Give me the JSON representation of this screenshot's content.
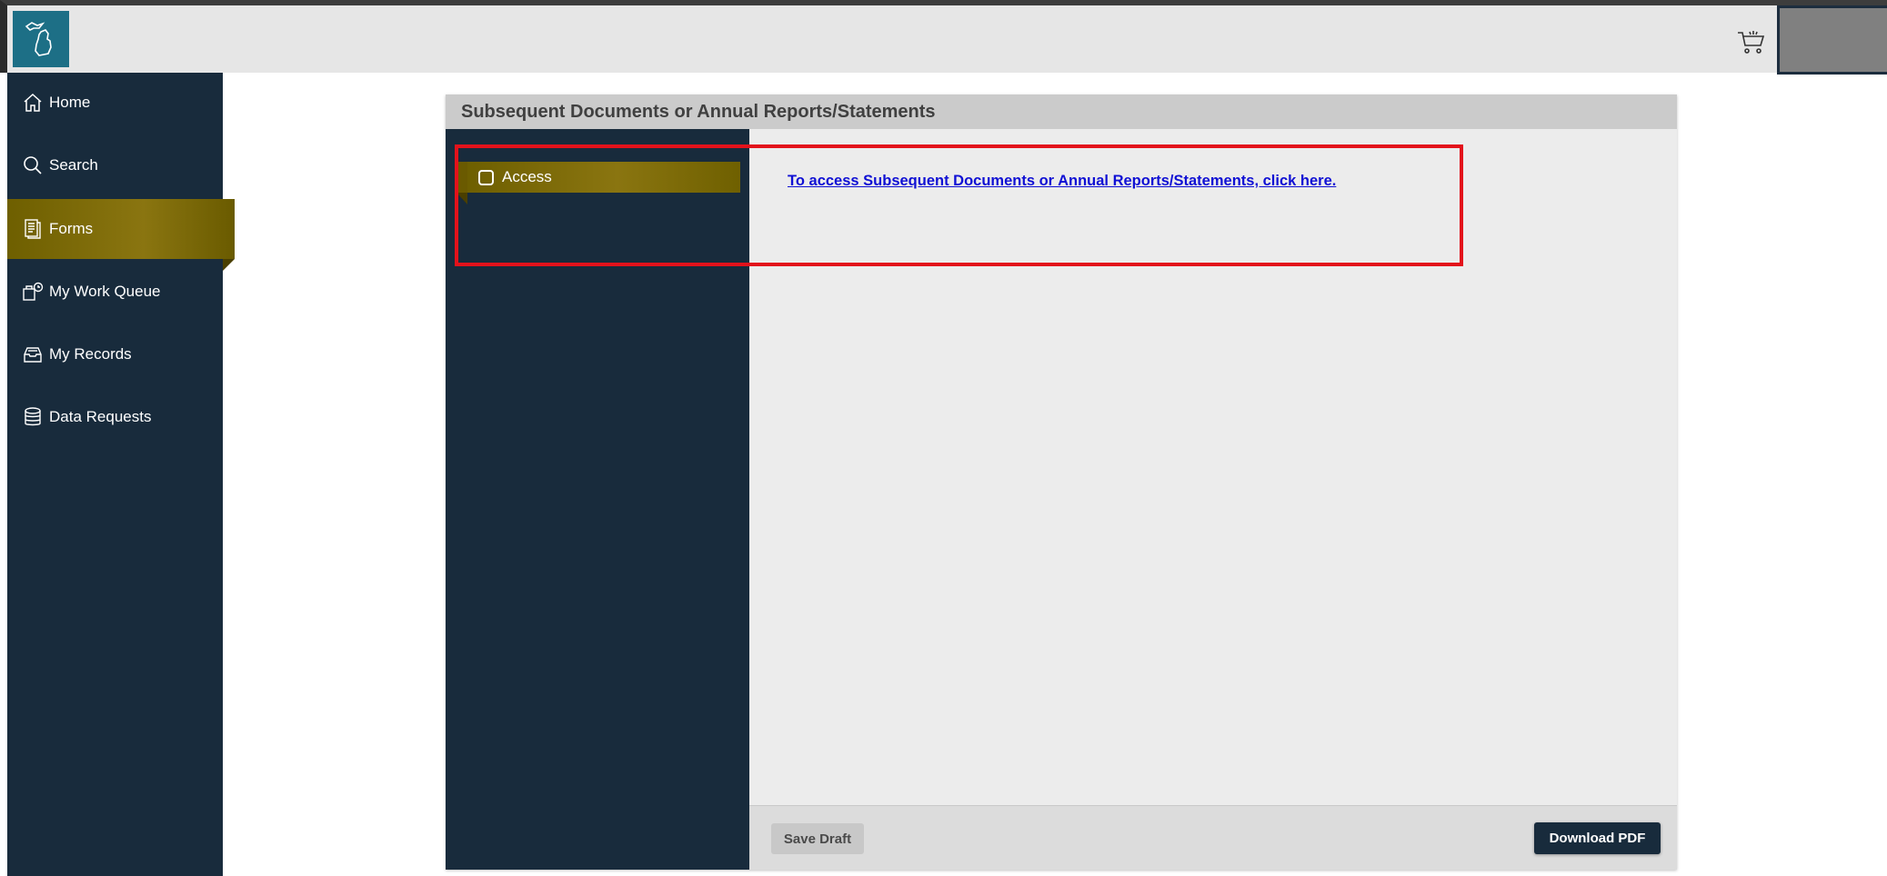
{
  "header": {
    "logo_icon": "michigan-map-icon",
    "cart_icon": "shopping-cart-icon"
  },
  "sidebar": {
    "items": [
      {
        "label": "Home",
        "icon": "home-icon"
      },
      {
        "label": "Search",
        "icon": "search-icon"
      },
      {
        "label": "Forms",
        "icon": "forms-document-icon",
        "active": true
      },
      {
        "label": "My Work Queue",
        "icon": "work-queue-icon"
      },
      {
        "label": "My Records",
        "icon": "records-icon"
      },
      {
        "label": "Data Requests",
        "icon": "database-icon"
      }
    ]
  },
  "form": {
    "title": "Subsequent Documents or Annual Reports/Statements",
    "sections": [
      {
        "label": "Access",
        "checked": false
      }
    ],
    "link_text": "To access Subsequent Documents or Annual Reports/Statements, click here.",
    "save_draft_label": "Save Draft",
    "download_pdf_label": "Download PDF"
  },
  "colors": {
    "navy": "#182b3c",
    "gold": "#7b6a05",
    "link": "#1010d4",
    "highlight": "#e3121b",
    "logo_bg": "#1d6f86"
  }
}
